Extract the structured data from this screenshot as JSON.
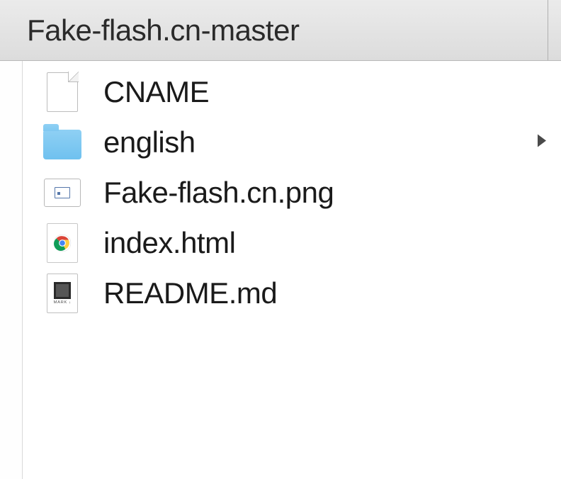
{
  "window": {
    "title": "Fake-flash.cn-master"
  },
  "files": [
    {
      "name": "CNAME",
      "type": "file",
      "icon": "generic-file-icon",
      "has_children": false
    },
    {
      "name": "english",
      "type": "folder",
      "icon": "folder-icon",
      "has_children": true
    },
    {
      "name": "Fake-flash.cn.png",
      "type": "image",
      "icon": "image-file-icon",
      "has_children": false
    },
    {
      "name": "index.html",
      "type": "html",
      "icon": "chrome-html-icon",
      "has_children": false
    },
    {
      "name": "README.md",
      "type": "markdown",
      "icon": "markdown-file-icon",
      "has_children": false
    }
  ]
}
